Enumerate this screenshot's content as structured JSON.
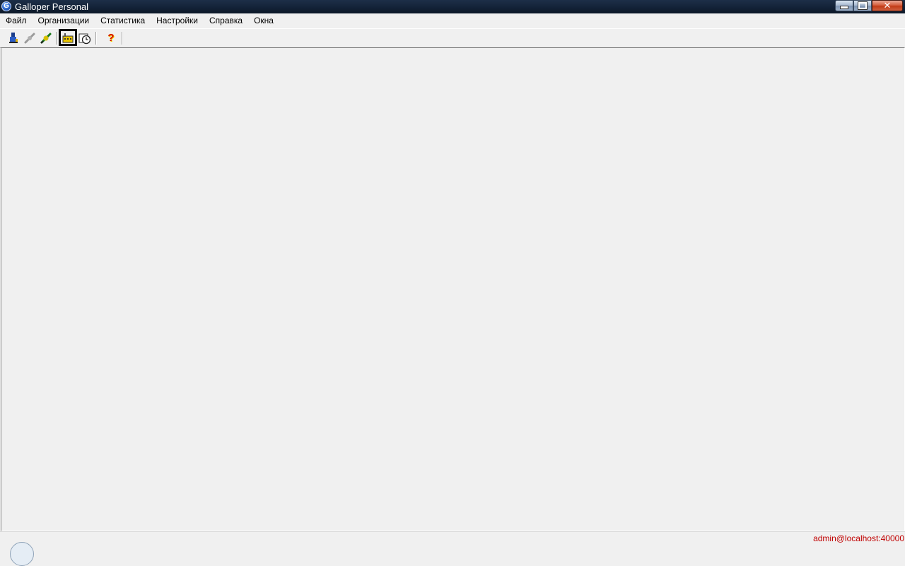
{
  "window": {
    "title": "Galloper Personal",
    "app_icon_letter": "G",
    "controls": {
      "close": "✕"
    }
  },
  "menu": {
    "items": [
      "Файл",
      "Организации",
      "Статистика",
      "Настройки",
      "Справка",
      "Окна"
    ]
  },
  "toolbar": {
    "buttons": [
      {
        "icon": "connect-user-icon",
        "active": false,
        "enabled": true
      },
      {
        "icon": "disconnect-plug-icon",
        "active": false,
        "enabled": false
      },
      {
        "icon": "connect-plug-icon",
        "active": false,
        "enabled": true
      },
      {
        "icon": "organizations-factory-icon",
        "active": true,
        "enabled": true
      },
      {
        "icon": "statistics-clock-icon",
        "active": false,
        "enabled": true
      },
      {
        "icon": "help-question-icon",
        "active": false,
        "enabled": true,
        "label": "?"
      }
    ]
  },
  "statusbar": {
    "connection": "admin@localhost:40000",
    "connection_color": "#c00000"
  }
}
